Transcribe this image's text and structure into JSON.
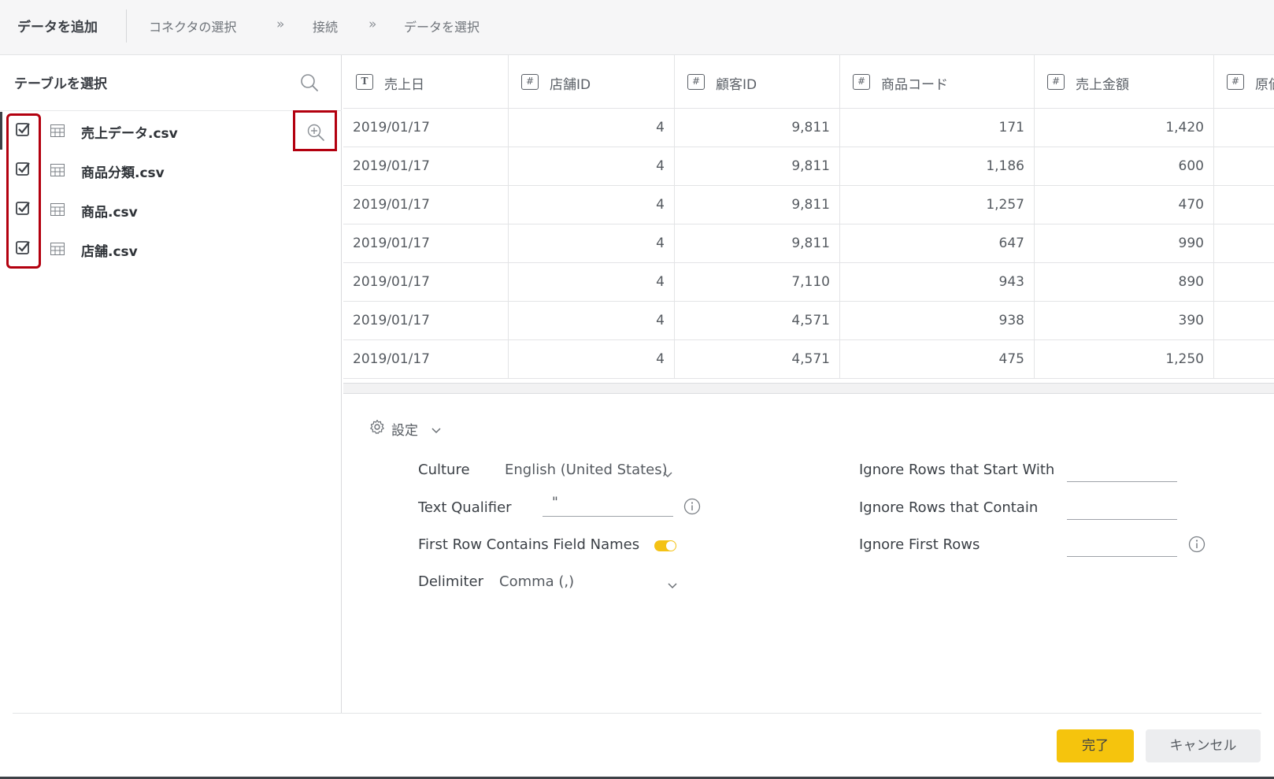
{
  "header": {
    "title": "データを追加",
    "steps": [
      "コネクタの選択",
      "接続",
      "データを選択"
    ],
    "separator": "»"
  },
  "left_panel": {
    "title": "テーブルを選択",
    "tables": [
      {
        "name": "売上データ.csv",
        "checked": true
      },
      {
        "name": "商品分類.csv",
        "checked": true
      },
      {
        "name": "商品.csv",
        "checked": true
      },
      {
        "name": "店舗.csv",
        "checked": true
      }
    ]
  },
  "grid": {
    "columns": [
      {
        "type": "T",
        "label": "売上日"
      },
      {
        "type": "#",
        "label": "店舗ID"
      },
      {
        "type": "#",
        "label": "顧客ID"
      },
      {
        "type": "#",
        "label": "商品コード"
      },
      {
        "type": "#",
        "label": "売上金額"
      },
      {
        "type": "#",
        "label": "原価"
      }
    ],
    "rows": [
      [
        "2019/01/17",
        "4",
        "9,811",
        "171",
        "1,420",
        ""
      ],
      [
        "2019/01/17",
        "4",
        "9,811",
        "1,186",
        "600",
        ""
      ],
      [
        "2019/01/17",
        "4",
        "9,811",
        "1,257",
        "470",
        ""
      ],
      [
        "2019/01/17",
        "4",
        "9,811",
        "647",
        "990",
        ""
      ],
      [
        "2019/01/17",
        "4",
        "7,110",
        "943",
        "890",
        ""
      ],
      [
        "2019/01/17",
        "4",
        "4,571",
        "938",
        "390",
        ""
      ],
      [
        "2019/01/17",
        "4",
        "4,571",
        "475",
        "1,250",
        ""
      ]
    ]
  },
  "settings": {
    "toggle_label": "設定",
    "culture_label": "Culture",
    "culture_value": "English (United States)",
    "text_qualifier_label": "Text Qualifier",
    "text_qualifier_value": "\"",
    "first_row_label": "First Row Contains Field Names",
    "first_row_enabled": true,
    "delimiter_label": "Delimiter",
    "delimiter_value": "Comma (,)",
    "ignore_start_label": "Ignore Rows that Start With",
    "ignore_start_value": "",
    "ignore_contain_label": "Ignore Rows that Contain",
    "ignore_contain_value": "",
    "ignore_first_label": "Ignore First Rows",
    "ignore_first_value": ""
  },
  "footer": {
    "done_label": "完了",
    "cancel_label": "キャンセル"
  },
  "colors": {
    "accent": "#f5c40d",
    "highlight": "#b3000f"
  }
}
